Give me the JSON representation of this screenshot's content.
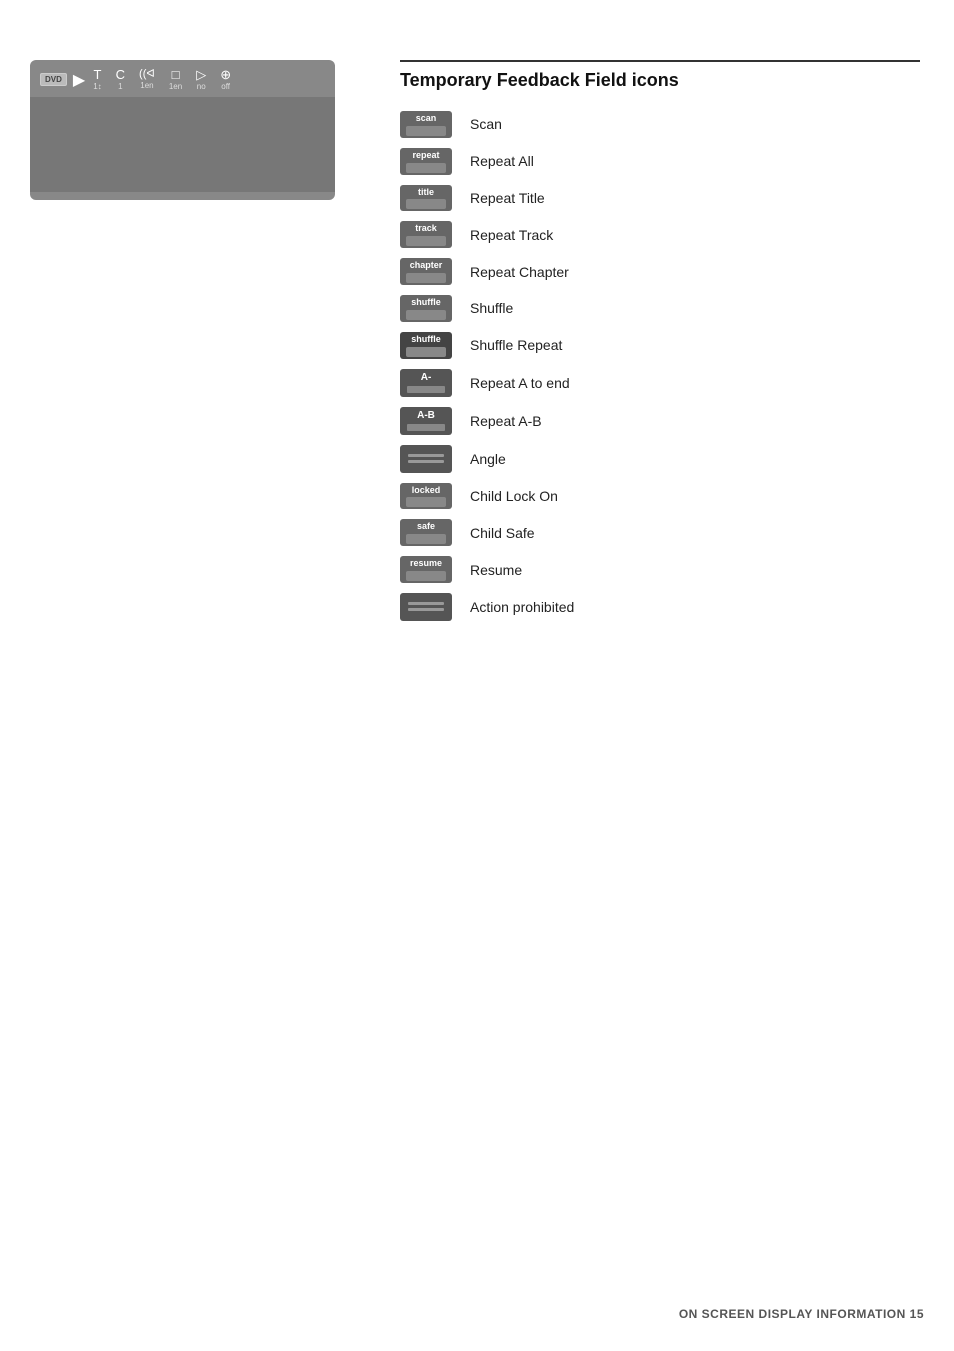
{
  "section": {
    "title": "Temporary Feedback Field icons",
    "line": true
  },
  "osd": {
    "dvd_label": "DVD",
    "controls": [
      {
        "icon": "T",
        "sub": "1↕"
      },
      {
        "icon": "C",
        "sub": "1"
      },
      {
        "icon": "((ᐊ",
        "sub": "1en"
      },
      {
        "icon": "□",
        "sub": "1en"
      },
      {
        "icon": "▷",
        "sub": "no"
      },
      {
        "icon": "⊕",
        "sub": "off"
      }
    ]
  },
  "icons": [
    {
      "badge": "scan",
      "label": "Scan"
    },
    {
      "badge": "repeat",
      "label": "Repeat All"
    },
    {
      "badge": "title",
      "label": "Repeat Title"
    },
    {
      "badge": "track",
      "label": "Repeat Track"
    },
    {
      "badge": "chapter",
      "label": "Repeat Chapter"
    },
    {
      "badge": "shuffle",
      "label": "Shuffle"
    },
    {
      "badge": "shuffle",
      "label": "Shuffle Repeat"
    },
    {
      "badge": "A-",
      "label": "Repeat A to end"
    },
    {
      "badge": "A-B",
      "label": "Repeat A-B"
    },
    {
      "badge": "angle",
      "label": "Angle"
    },
    {
      "badge": "locked",
      "label": "Child Lock On"
    },
    {
      "badge": "safe",
      "label": "Child Safe"
    },
    {
      "badge": "resume",
      "label": "Resume"
    },
    {
      "badge": "prohibited",
      "label": "Action prohibited"
    }
  ],
  "footer": {
    "text": "ON SCREEN DISPLAY INFORMATION 15"
  }
}
